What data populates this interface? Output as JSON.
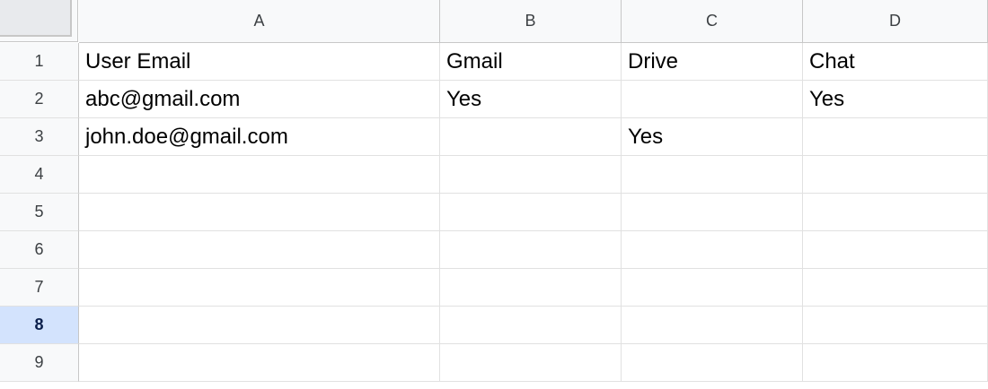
{
  "sheet": {
    "columns": [
      "A",
      "B",
      "C",
      "D"
    ],
    "row_numbers": [
      "1",
      "2",
      "3",
      "4",
      "5",
      "6",
      "7",
      "8",
      "9"
    ],
    "selected_row": "8",
    "rows": [
      [
        "User Email",
        "Gmail",
        "Drive",
        "Chat"
      ],
      [
        "abc@gmail.com",
        "Yes",
        "",
        "Yes"
      ],
      [
        "john.doe@gmail.com",
        "",
        "Yes",
        ""
      ],
      [
        "",
        "",
        "",
        ""
      ],
      [
        "",
        "",
        "",
        ""
      ],
      [
        "",
        "",
        "",
        ""
      ],
      [
        "",
        "",
        "",
        ""
      ],
      [
        "",
        "",
        "",
        ""
      ],
      [
        "",
        "",
        "",
        ""
      ]
    ]
  }
}
